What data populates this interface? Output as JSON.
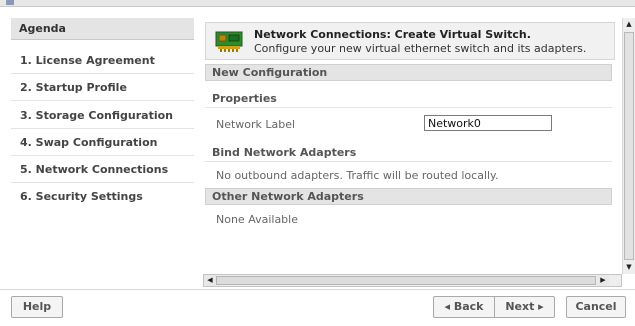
{
  "sidebar": {
    "header": "Agenda",
    "items": [
      {
        "label": "1. License Agreement"
      },
      {
        "label": "2. Startup Profile"
      },
      {
        "label": "3. Storage Configuration"
      },
      {
        "label": "4. Swap Configuration"
      },
      {
        "label": "5. Network Connections"
      },
      {
        "label": "6. Security Settings"
      }
    ]
  },
  "main": {
    "header": {
      "icon": "network-adapter-icon",
      "title": "Network Connections: Create Virtual Switch.",
      "subtitle": "Configure your new virtual ethernet switch and its adapters."
    },
    "new_configuration": "New Configuration",
    "properties": {
      "heading": "Properties",
      "network_label": "Network Label",
      "network_label_value": "Network0"
    },
    "bind_adapters": {
      "heading": "Bind Network Adapters",
      "message": "No outbound adapters. Traffic will be routed locally."
    },
    "other_adapters": {
      "heading": "Other Network Adapters",
      "message": "None Available"
    }
  },
  "footer": {
    "help": "Help",
    "back": "◂ Back",
    "next": "Next ▸",
    "cancel": "Cancel"
  },
  "scrollbars": {
    "up": "▲",
    "down": "▼",
    "left": "◀",
    "right": "▶"
  }
}
